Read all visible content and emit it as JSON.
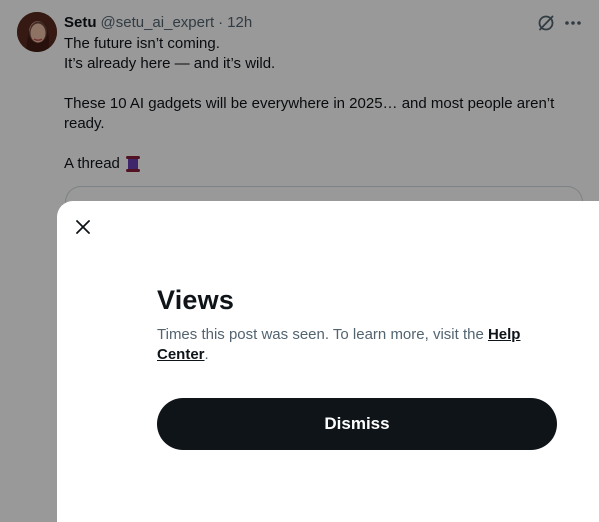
{
  "tweet": {
    "author_name": "Setu",
    "author_handle": "@setu_ai_expert",
    "separator": "·",
    "time": "12h",
    "lines": [
      "The future isn’t coming.",
      "It’s already here — and it’s wild.",
      "These 10 AI gadgets will be everywhere in 2025… and most people aren’t ready.",
      "A thread"
    ],
    "thread_emoji": "scroll-emoji"
  },
  "dialog": {
    "title": "Views",
    "description_prefix": "Times this post was seen. To learn more, visit the ",
    "link_label": "Help Center",
    "description_suffix": ".",
    "dismiss_label": "Dismiss"
  },
  "icons": {
    "close": "close-icon",
    "grok": "grok-icon",
    "more": "more-icon"
  },
  "colors": {
    "text_primary": "#0f1419",
    "text_secondary": "#536471",
    "button_bg": "#0f1419",
    "overlay": "rgba(0,0,0,0.4)"
  }
}
